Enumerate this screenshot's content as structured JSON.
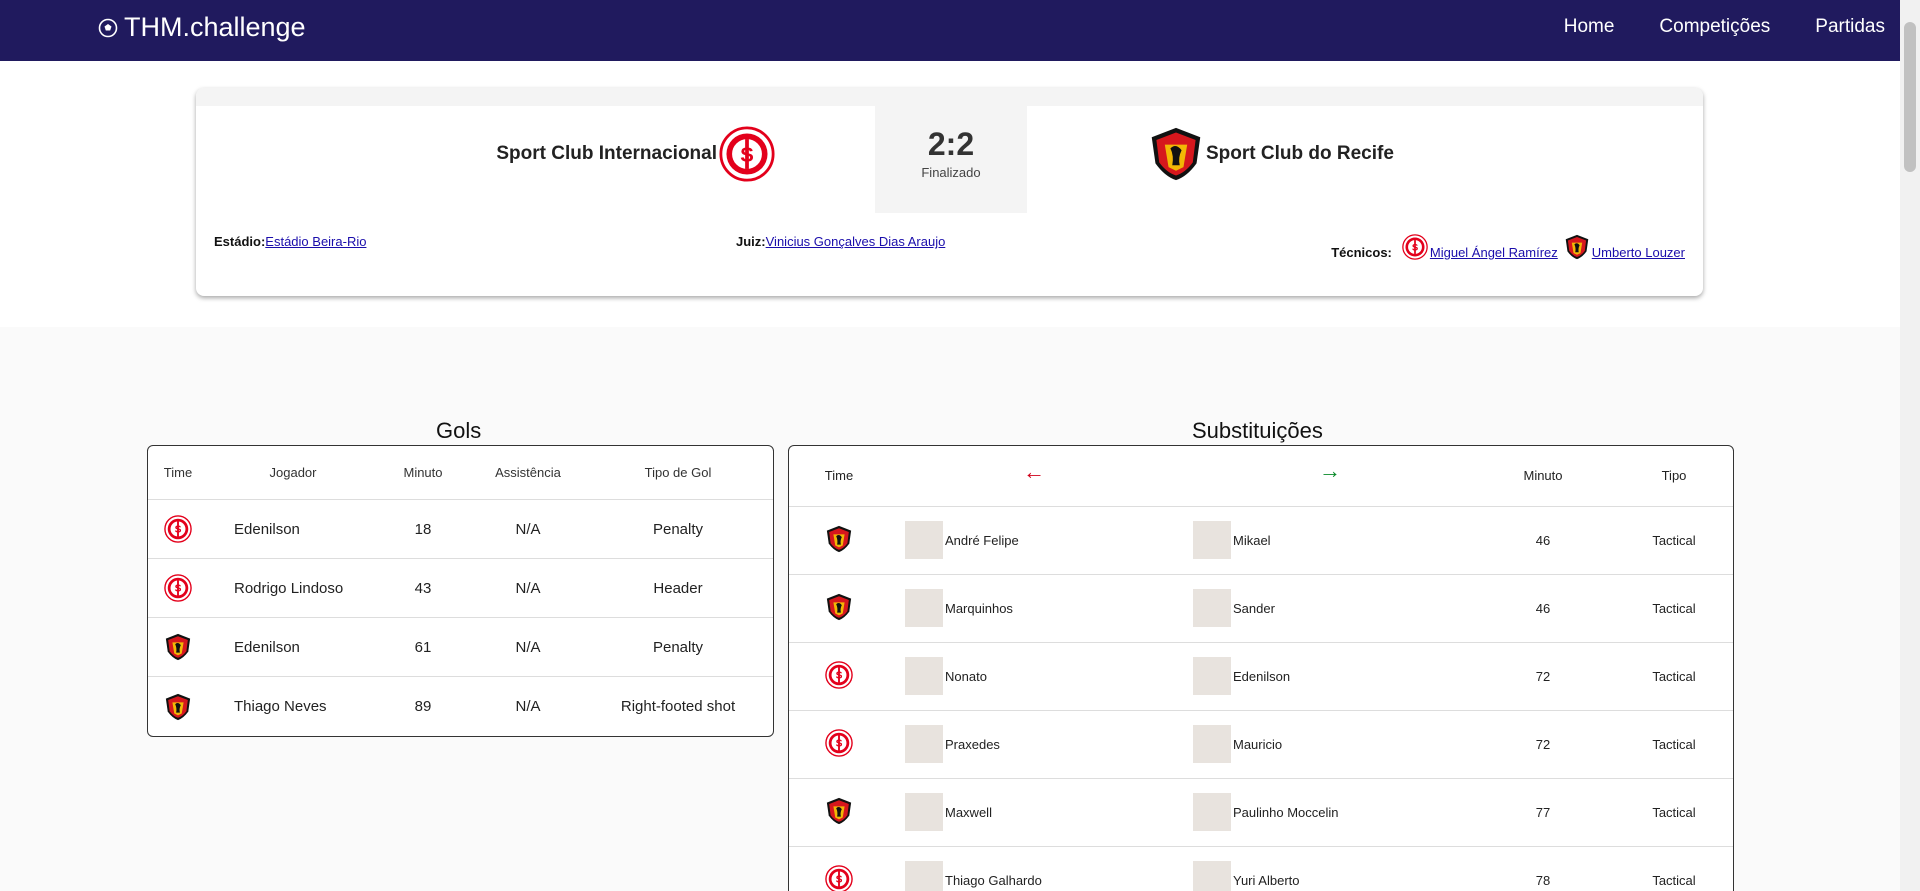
{
  "nav": {
    "brand": "THM.challenge",
    "links": [
      "Home",
      "Competições",
      "Partidas"
    ]
  },
  "match": {
    "home_team": "Sport Club Internacional",
    "away_team": "Sport Club do Recife",
    "score": "2:2",
    "status": "Finalizado",
    "stadium_label": "Estádio:",
    "stadium": "Estádio Beira-Rio",
    "referee_label": "Juiz:",
    "referee": "Vinicius Gonçalves Dias Araujo",
    "coaches_label": "Técnicos:",
    "home_coach": "Miguel Ángel Ramírez",
    "away_coach": "Umberto Louzer"
  },
  "goals": {
    "title": "Gols",
    "headers": [
      "Time",
      "Jogador",
      "Minuto",
      "Assistência",
      "Tipo de Gol"
    ],
    "rows": [
      {
        "team": "internacional",
        "player": "Edenilson",
        "minute": "18",
        "assist": "N/A",
        "type": "Penalty"
      },
      {
        "team": "internacional",
        "player": "Rodrigo Lindoso",
        "minute": "43",
        "assist": "N/A",
        "type": "Header"
      },
      {
        "team": "sport",
        "player": "Edenilson",
        "minute": "61",
        "assist": "N/A",
        "type": "Penalty"
      },
      {
        "team": "sport",
        "player": "Thiago Neves",
        "minute": "89",
        "assist": "N/A",
        "type": "Right-footed shot"
      }
    ]
  },
  "subs": {
    "title": "Substituições",
    "headers": {
      "team": "Time",
      "out_icon": "arrow-left-icon",
      "in_icon": "arrow-right-icon",
      "minute": "Minuto",
      "type": "Tipo"
    },
    "rows": [
      {
        "team": "sport",
        "out": "André Felipe",
        "in": "Mikael",
        "minute": "46",
        "type": "Tactical"
      },
      {
        "team": "sport",
        "out": "Marquinhos",
        "in": "Sander",
        "minute": "46",
        "type": "Tactical"
      },
      {
        "team": "internacional",
        "out": "Nonato",
        "in": "Edenilson",
        "minute": "72",
        "type": "Tactical"
      },
      {
        "team": "internacional",
        "out": "Praxedes",
        "in": "Mauricio",
        "minute": "72",
        "type": "Tactical"
      },
      {
        "team": "sport",
        "out": "Maxwell",
        "in": "Paulinho Moccelin",
        "minute": "77",
        "type": "Tactical"
      },
      {
        "team": "internacional",
        "out": "Thiago Galhardo",
        "in": "Yuri Alberto",
        "minute": "78",
        "type": "Tactical"
      }
    ]
  },
  "colors": {
    "nav_bg": "#201a5e",
    "inter_red": "#e3001b",
    "sport_red": "#d6171d",
    "arrow_out": "#d0021b",
    "arrow_in": "#0a8a2a",
    "link": "#1a0dab"
  }
}
